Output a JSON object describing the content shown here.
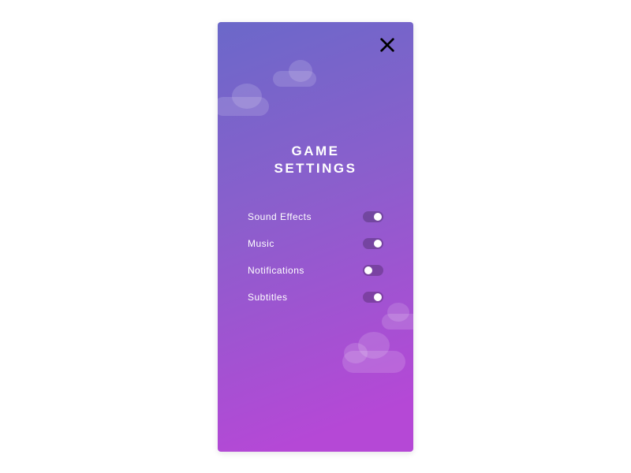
{
  "title_line1": "GAME",
  "title_line2": "SETTINGS",
  "settings": [
    {
      "label": "Sound Effects",
      "on": true
    },
    {
      "label": "Music",
      "on": true
    },
    {
      "label": "Notifications",
      "on": false
    },
    {
      "label": "Subtitles",
      "on": true
    }
  ]
}
